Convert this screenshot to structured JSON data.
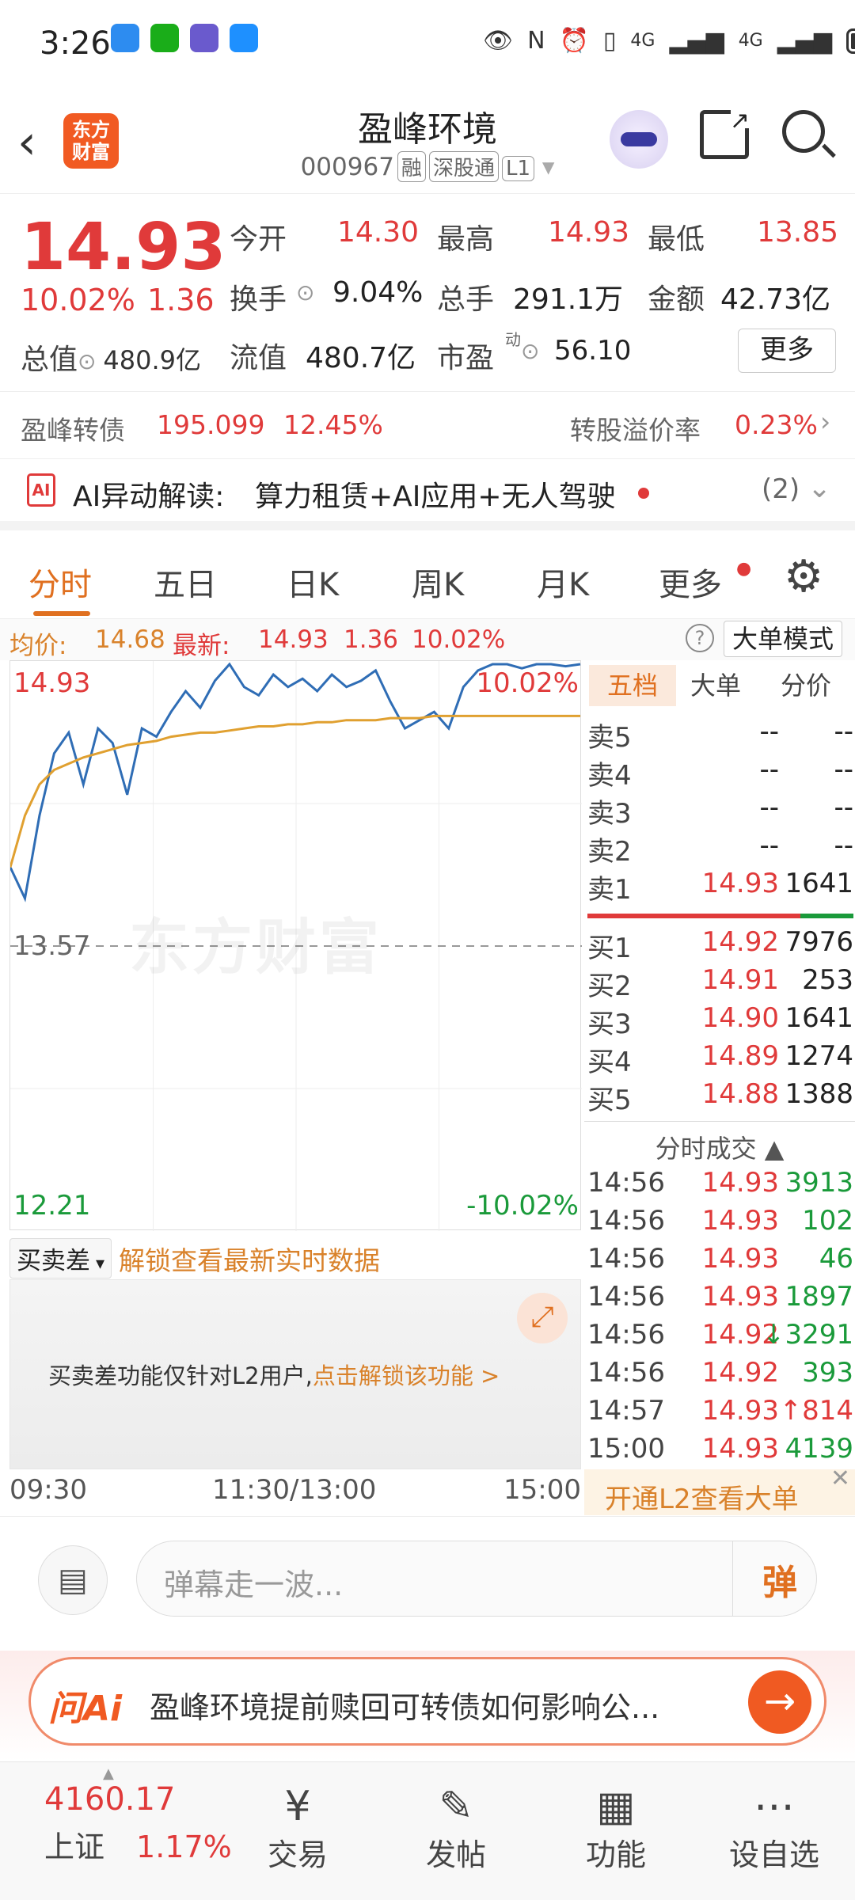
{
  "status": {
    "time": "3:26",
    "net1": "4G",
    "net2": "4G"
  },
  "header": {
    "logo_line1": "东方",
    "logo_line2": "财富",
    "name": "盈峰环境",
    "code": "000967",
    "tag1": "融",
    "tag2": "深股通",
    "tag3": "L1"
  },
  "quote": {
    "price": "14.93",
    "pct": "10.02%",
    "chg": "1.36",
    "open_label": "今开",
    "open": "14.30",
    "high_label": "最高",
    "high": "14.93",
    "low_label": "最低",
    "low": "13.85",
    "turnover_label": "换手",
    "turnover": "9.04%",
    "volume_label": "总手",
    "volume": "291.1万",
    "amount_label": "金额",
    "amount": "42.73亿",
    "mcap_label": "总值",
    "mcap": "480.9亿",
    "float_label": "流值",
    "float": "480.7亿",
    "pe_label": "市盈",
    "pe_sup": "动",
    "pe": "56.10",
    "more": "更多"
  },
  "bond": {
    "name": "盈峰转债",
    "price": "195.099",
    "pct": "12.45%",
    "premium_label": "转股溢价率",
    "premium": "0.23%"
  },
  "ai_row": {
    "label": "AI异动解读:",
    "text": "算力租赁+AI应用+无人驾驶",
    "count": "(2)"
  },
  "tabs": [
    "分时",
    "五日",
    "日K",
    "周K",
    "月K",
    "更多"
  ],
  "infobar": {
    "avg_label": "均价:",
    "avg": "14.68",
    "latest_label": "最新:",
    "latest": "14.93",
    "chg": "1.36",
    "pct": "10.02%",
    "mode": "大单模式"
  },
  "chart_axis": {
    "top_price": "14.93",
    "top_pct": "10.02%",
    "mid_price": "13.57",
    "bottom_price": "12.21",
    "bottom_pct": "-10.02%",
    "watermark": "东方财富"
  },
  "chart_data": {
    "type": "line",
    "x_labels": [
      "09:30",
      "11:30/13:00",
      "15:00"
    ],
    "ylim": [
      12.21,
      14.93
    ],
    "series": [
      {
        "values": [
          13.95,
          13.8,
          14.2,
          14.5,
          14.6,
          14.35,
          14.62,
          14.55,
          14.3,
          14.62,
          14.58,
          14.7,
          14.8,
          14.72,
          14.85,
          14.93,
          14.82,
          14.78,
          14.88,
          14.82,
          14.86,
          14.8,
          14.88,
          14.82,
          14.85,
          14.9,
          14.75,
          14.62,
          14.66,
          14.7,
          14.62,
          14.82,
          14.9,
          14.93,
          14.93,
          14.91,
          14.93,
          14.93,
          14.92,
          14.93
        ],
        "color": "#2f6db5"
      },
      {
        "values": [
          13.95,
          14.2,
          14.35,
          14.42,
          14.45,
          14.48,
          14.5,
          14.52,
          14.54,
          14.55,
          14.56,
          14.58,
          14.59,
          14.6,
          14.6,
          14.61,
          14.62,
          14.63,
          14.63,
          14.64,
          14.64,
          14.65,
          14.65,
          14.66,
          14.66,
          14.66,
          14.67,
          14.67,
          14.67,
          14.68,
          14.68,
          14.68,
          14.68,
          14.68,
          14.68,
          14.68,
          14.68,
          14.68,
          14.68,
          14.68
        ],
        "color": "#e0a030"
      }
    ]
  },
  "orderbook": {
    "tabs": [
      "五档",
      "大单",
      "分价"
    ],
    "asks": [
      {
        "label": "卖5",
        "price": "--",
        "vol": "--"
      },
      {
        "label": "卖4",
        "price": "--",
        "vol": "--"
      },
      {
        "label": "卖3",
        "price": "--",
        "vol": "--"
      },
      {
        "label": "卖2",
        "price": "--",
        "vol": "--"
      },
      {
        "label": "卖1",
        "price": "14.93",
        "vol": "1641"
      }
    ],
    "bids": [
      {
        "label": "买1",
        "price": "14.92",
        "vol": "7976"
      },
      {
        "label": "买2",
        "price": "14.91",
        "vol": "253"
      },
      {
        "label": "买3",
        "price": "14.90",
        "vol": "1641"
      },
      {
        "label": "买4",
        "price": "14.89",
        "vol": "1274"
      },
      {
        "label": "买5",
        "price": "14.88",
        "vol": "1388"
      }
    ],
    "trades_title": "分时成交",
    "trades": [
      {
        "t": "14:56",
        "p": "14.93",
        "v": "3913",
        "arrow": ""
      },
      {
        "t": "14:56",
        "p": "14.93",
        "v": "102",
        "arrow": ""
      },
      {
        "t": "14:56",
        "p": "14.93",
        "v": "46",
        "arrow": ""
      },
      {
        "t": "14:56",
        "p": "14.93",
        "v": "1897",
        "arrow": ""
      },
      {
        "t": "14:56",
        "p": "14.92",
        "v": "3291",
        "arrow": "↓"
      },
      {
        "t": "14:56",
        "p": "14.92",
        "v": "393",
        "arrow": ""
      },
      {
        "t": "14:57",
        "p": "14.93",
        "v": "814",
        "arrow": "↑"
      },
      {
        "t": "15:00",
        "p": "14.93",
        "v": "4139",
        "arrow": ""
      }
    ],
    "l2": "开通L2查看大单"
  },
  "bsd": {
    "label": "买卖差",
    "unlock": "解锁查看最新实时数据",
    "msg": "买卖差功能仅针对L2用户,",
    "link": "点击解锁该功能 >"
  },
  "danmu": {
    "placeholder": "弹幕走一波...",
    "btn": "弹"
  },
  "askai": {
    "logo": "问Ai",
    "text": "盈峰环境提前赎回可转债如何影响公..."
  },
  "nav": {
    "index_val": "4160.17",
    "index_name": "上证",
    "index_pct": "1.17%",
    "items": [
      "交易",
      "发帖",
      "功能",
      "设自选"
    ]
  }
}
